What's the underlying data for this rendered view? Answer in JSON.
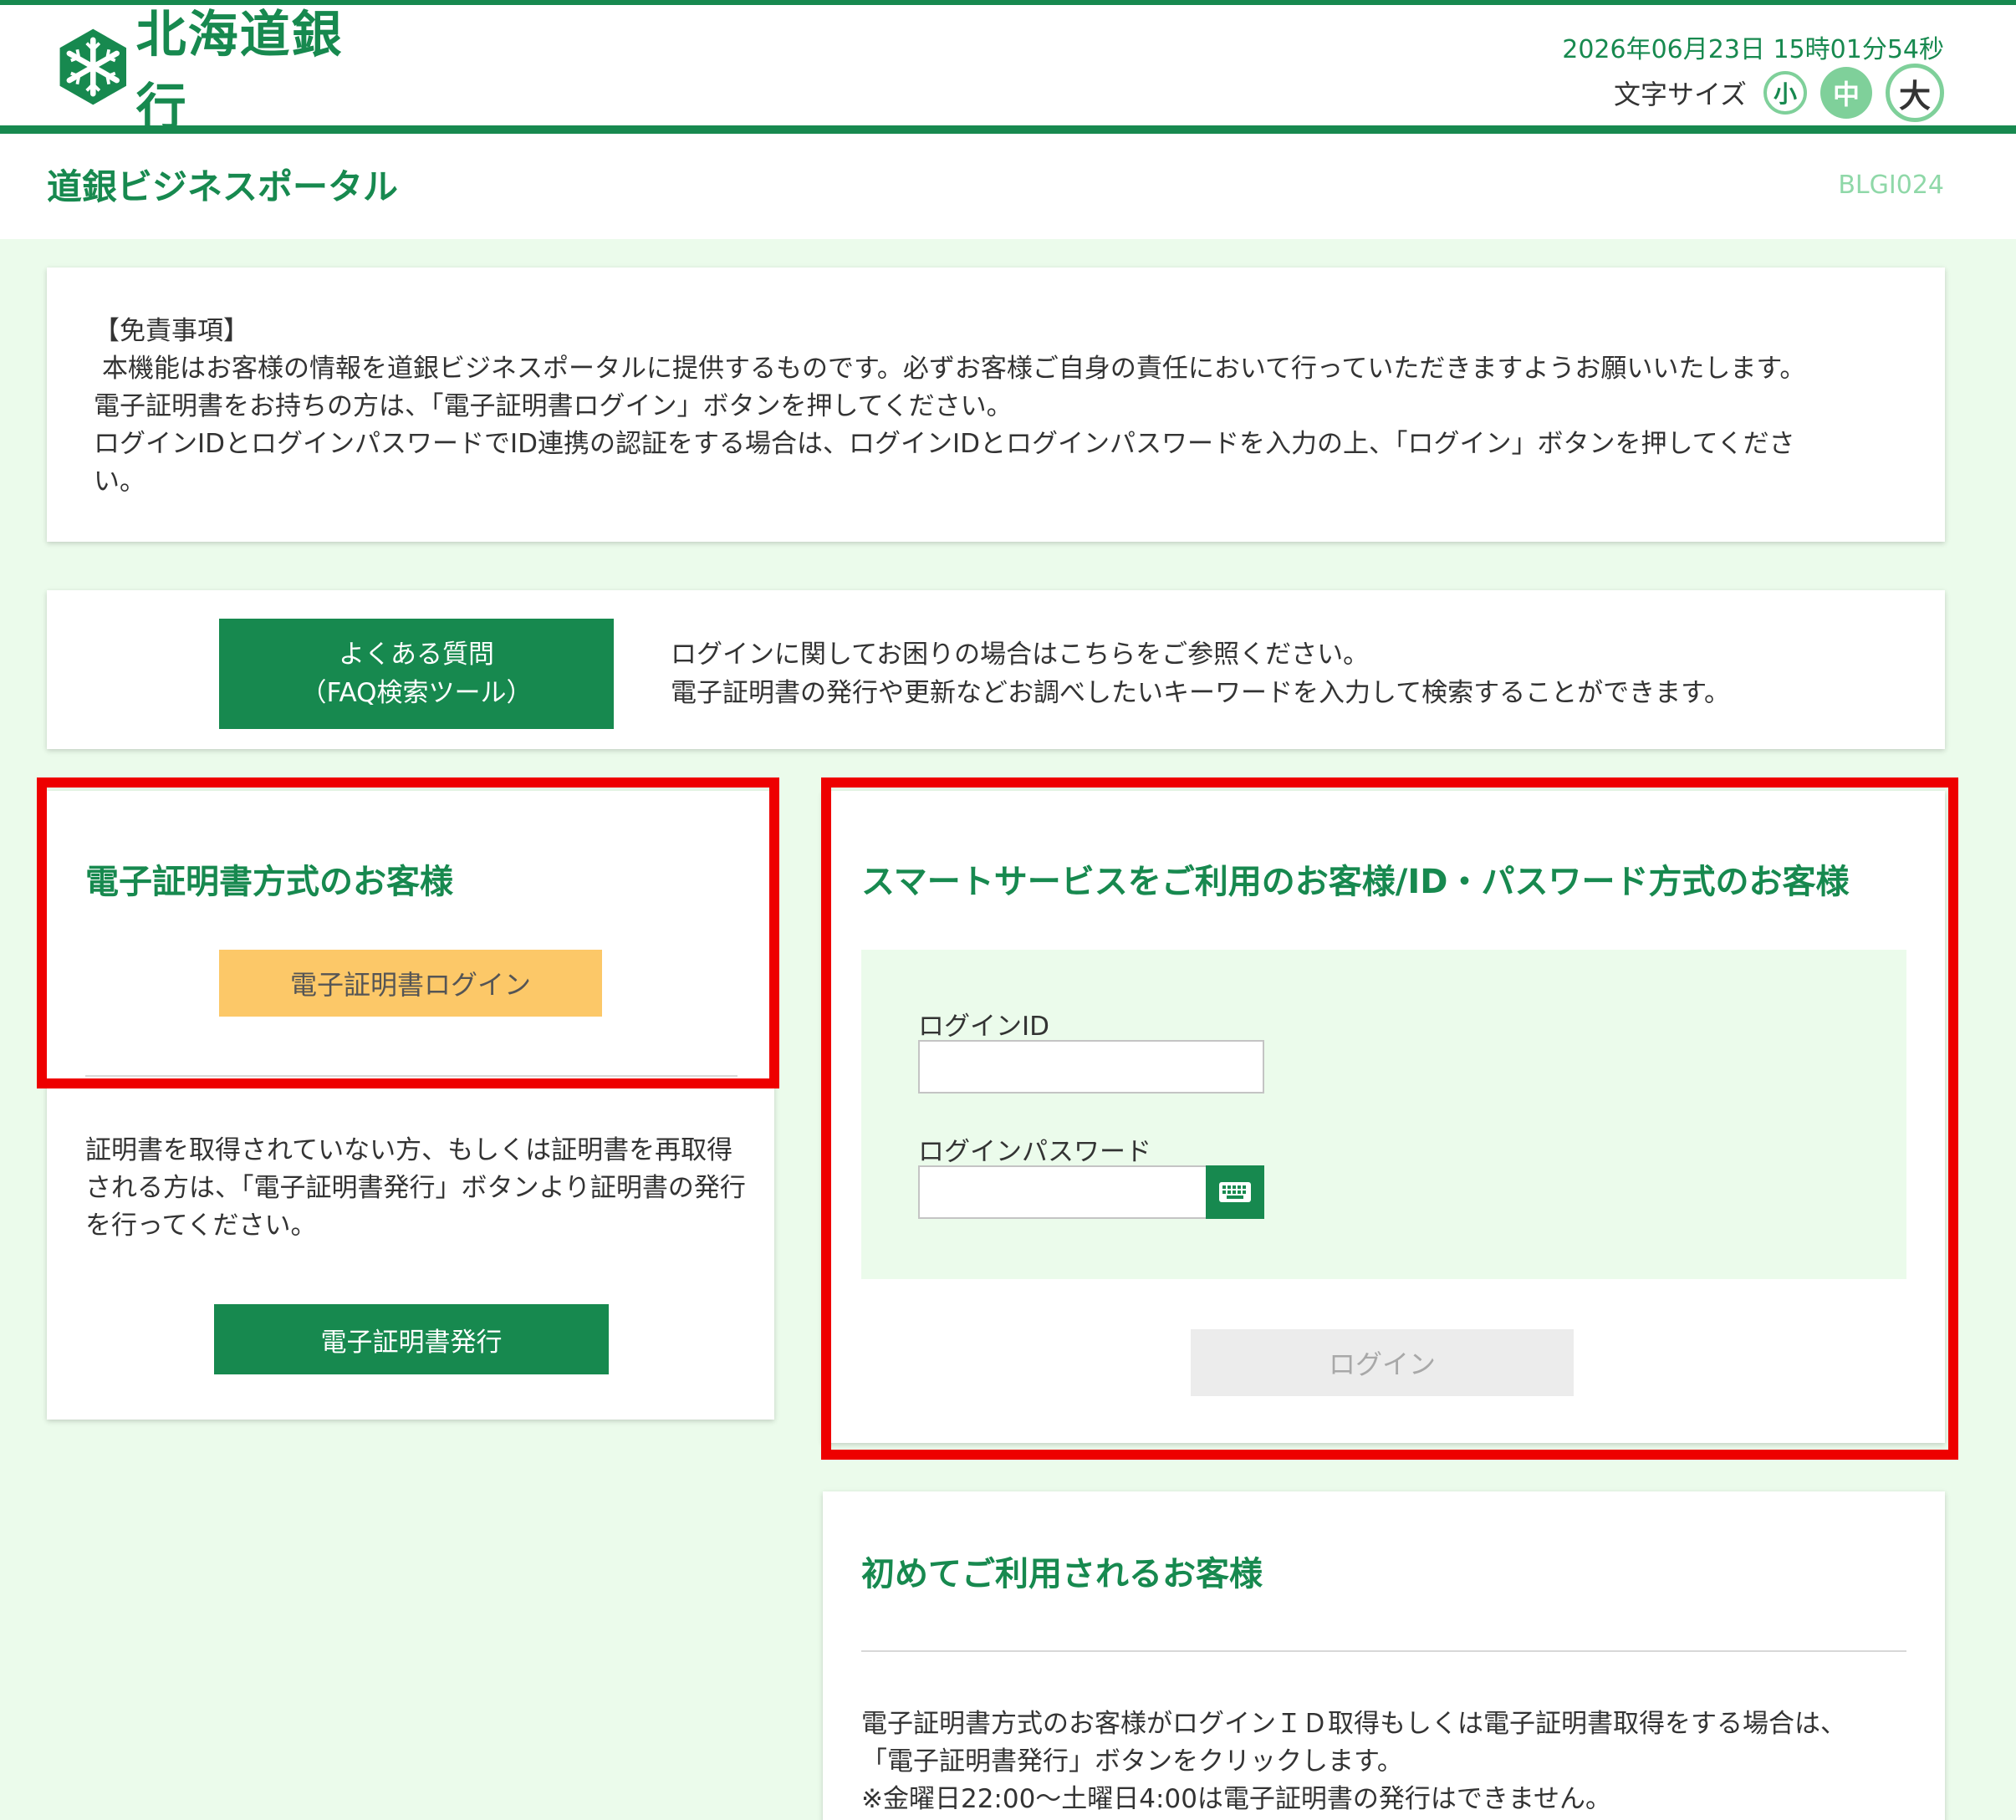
{
  "header": {
    "bank_name": "北海道銀行",
    "datetime": "2026年06月23日 15時01分54秒",
    "font_size_label": "文字サイズ",
    "font_size_small": "小",
    "font_size_medium": "中",
    "font_size_large": "大",
    "brand_color": "#17894f"
  },
  "title_bar": {
    "page_title": "道銀ビジネスポータル",
    "screen_id": "BLGI024"
  },
  "disclaimer": {
    "heading": "【免責事項】",
    "line1": "本機能はお客様の情報を道銀ビジネスポータルに提供するものです。必ずお客様ご自身の責任において行っていただきますようお願いいたします。",
    "line2": "電子証明書をお持ちの方は、「電子証明書ログイン」ボタンを押してください。",
    "line3": "ログインIDとログインパスワードでID連携の認証をする場合は、ログインIDとログインパスワードを入力の上、「ログイン」ボタンを押してくださ",
    "line4": "い。"
  },
  "faq": {
    "button_line1": "よくある質問",
    "button_line2": "（FAQ検索ツール）",
    "text_line1": "ログインに関してお困りの場合はこちらをご参照ください。",
    "text_line2": "電子証明書の発行や更新などお調べしたいキーワードを入力して検索することができます。"
  },
  "certificate_section": {
    "title": "電子証明書方式のお客様",
    "login_button": "電子証明書ログイン",
    "description": "証明書を取得されていない方、もしくは証明書を再取得される方は、「電子証明書発行」ボタンより証明書の発行を行ってください。",
    "issue_button": "電子証明書発行"
  },
  "smart_section": {
    "title": "スマートサービスをご利用のお客様/ID・パスワード方式のお客様",
    "login_id_label": "ログインID",
    "login_id_value": "",
    "password_label": "ログインパスワード",
    "password_value": "",
    "keyboard_icon": "keyboard-icon",
    "login_button": "ログイン"
  },
  "first_time_section": {
    "title": "初めてご利用されるお客様",
    "line1": "電子証明書方式のお客様がログインＩＤ取得もしくは電子証明書取得をする場合は、",
    "line2": "「電子証明書発行」ボタンをクリックします。",
    "line3": "※金曜日22:00～土曜日4:00は電子証明書の発行はできません。"
  },
  "highlight_color": "#ee0000"
}
